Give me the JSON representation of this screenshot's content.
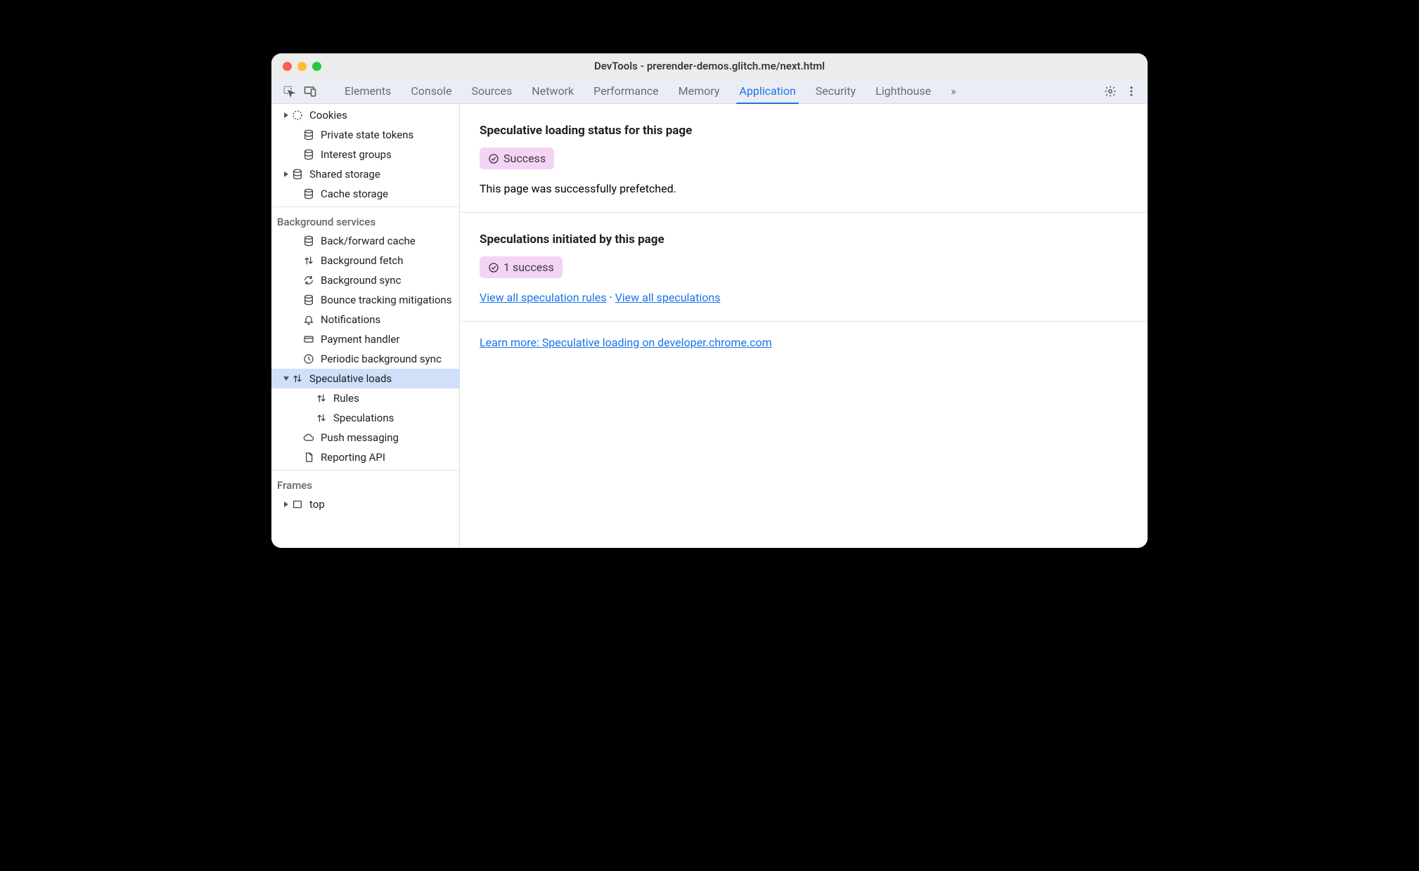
{
  "window": {
    "title": "DevTools - prerender-demos.glitch.me/next.html"
  },
  "tabs": {
    "items": [
      "Elements",
      "Console",
      "Sources",
      "Network",
      "Performance",
      "Memory",
      "Application",
      "Security",
      "Lighthouse"
    ],
    "more": "»",
    "active": "Application"
  },
  "sidebar": {
    "storage": [
      {
        "label": "Cookies",
        "icon": "cookie",
        "arrow": "right"
      },
      {
        "label": "Private state tokens",
        "icon": "db"
      },
      {
        "label": "Interest groups",
        "icon": "db"
      },
      {
        "label": "Shared storage",
        "icon": "db",
        "arrow": "right"
      },
      {
        "label": "Cache storage",
        "icon": "db"
      }
    ],
    "bg_header": "Background services",
    "bg": [
      {
        "label": "Back/forward cache",
        "icon": "db"
      },
      {
        "label": "Background fetch",
        "icon": "updown"
      },
      {
        "label": "Background sync",
        "icon": "sync"
      },
      {
        "label": "Bounce tracking mitigations",
        "icon": "db"
      },
      {
        "label": "Notifications",
        "icon": "bell"
      },
      {
        "label": "Payment handler",
        "icon": "card"
      },
      {
        "label": "Periodic background sync",
        "icon": "clock"
      },
      {
        "label": "Speculative loads",
        "icon": "updown",
        "arrow": "down",
        "selected": true
      },
      {
        "label": "Rules",
        "icon": "updown",
        "child": true
      },
      {
        "label": "Speculations",
        "icon": "updown",
        "child": true
      },
      {
        "label": "Push messaging",
        "icon": "cloud"
      },
      {
        "label": "Reporting API",
        "icon": "doc"
      }
    ],
    "frames_header": "Frames",
    "frames": [
      {
        "label": "top",
        "icon": "frame",
        "arrow": "right"
      }
    ]
  },
  "panel": {
    "status": {
      "heading": "Speculative loading status for this page",
      "badge": "Success",
      "desc": "This page was successfully prefetched."
    },
    "initiated": {
      "heading": "Speculations initiated by this page",
      "badge": "1 success",
      "link_rules": "View all speculation rules",
      "separator": " · ",
      "link_specs": "View all speculations"
    },
    "learn": "Learn more: Speculative loading on developer.chrome.com"
  }
}
